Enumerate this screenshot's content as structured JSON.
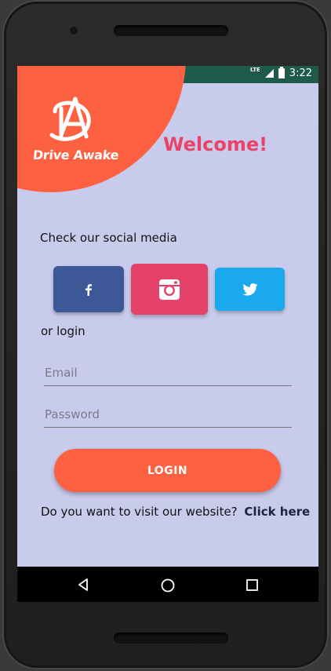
{
  "status_bar": {
    "time": "3:22",
    "network": "LTE",
    "left_icons": [
      "sd-card-icon",
      "android-icon"
    ],
    "right_icons": [
      "signal-icon",
      "battery-icon"
    ]
  },
  "brand": {
    "name": "Drive Awake",
    "header_color": "#fd6141"
  },
  "welcome": "Welcome!",
  "social": {
    "title": "Check our social media",
    "buttons": [
      {
        "name": "facebook",
        "icon": "facebook-icon",
        "color": "#3c5897"
      },
      {
        "name": "instagram",
        "icon": "instagram-icon",
        "color": "#e5426a"
      },
      {
        "name": "twitter",
        "icon": "twitter-icon",
        "color": "#1ba9ee"
      }
    ]
  },
  "login": {
    "or_label": "or login",
    "email_placeholder": "Email",
    "password_placeholder": "Password",
    "button_label": "LOGIN"
  },
  "website": {
    "prompt": "Do you want to visit our website?",
    "link": "Click here"
  },
  "nav_bar": [
    "back-icon",
    "home-icon",
    "recents-icon"
  ],
  "colors": {
    "background": "#c9cbec",
    "status_bar": "#1d5a4a",
    "accent": "#fd6141",
    "welcome": "#ea4368"
  }
}
